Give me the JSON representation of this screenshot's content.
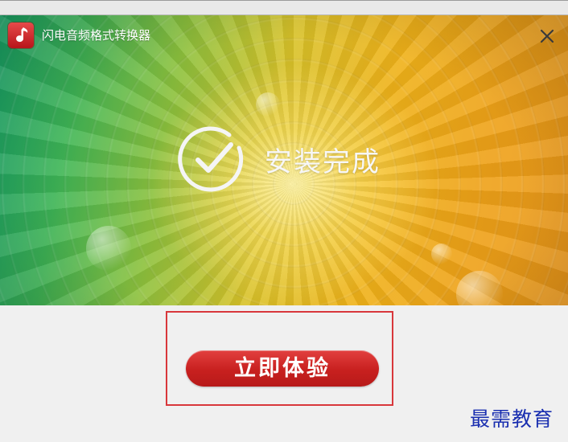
{
  "window": {
    "title": "闪电音频格式转换器",
    "app_icon": "music-note-icon",
    "close_icon": "close-icon"
  },
  "banner": {
    "status_text": "安装完成",
    "status_icon": "check-circle-icon",
    "colors": {
      "left": "#1aa86a",
      "center": "#f3d24a",
      "right": "#e9961a"
    }
  },
  "actions": {
    "start_button_label": "立即体验",
    "button_color": "#c8201f",
    "highlight_color": "#d8373b"
  },
  "watermark": {
    "text": "最需教育"
  }
}
